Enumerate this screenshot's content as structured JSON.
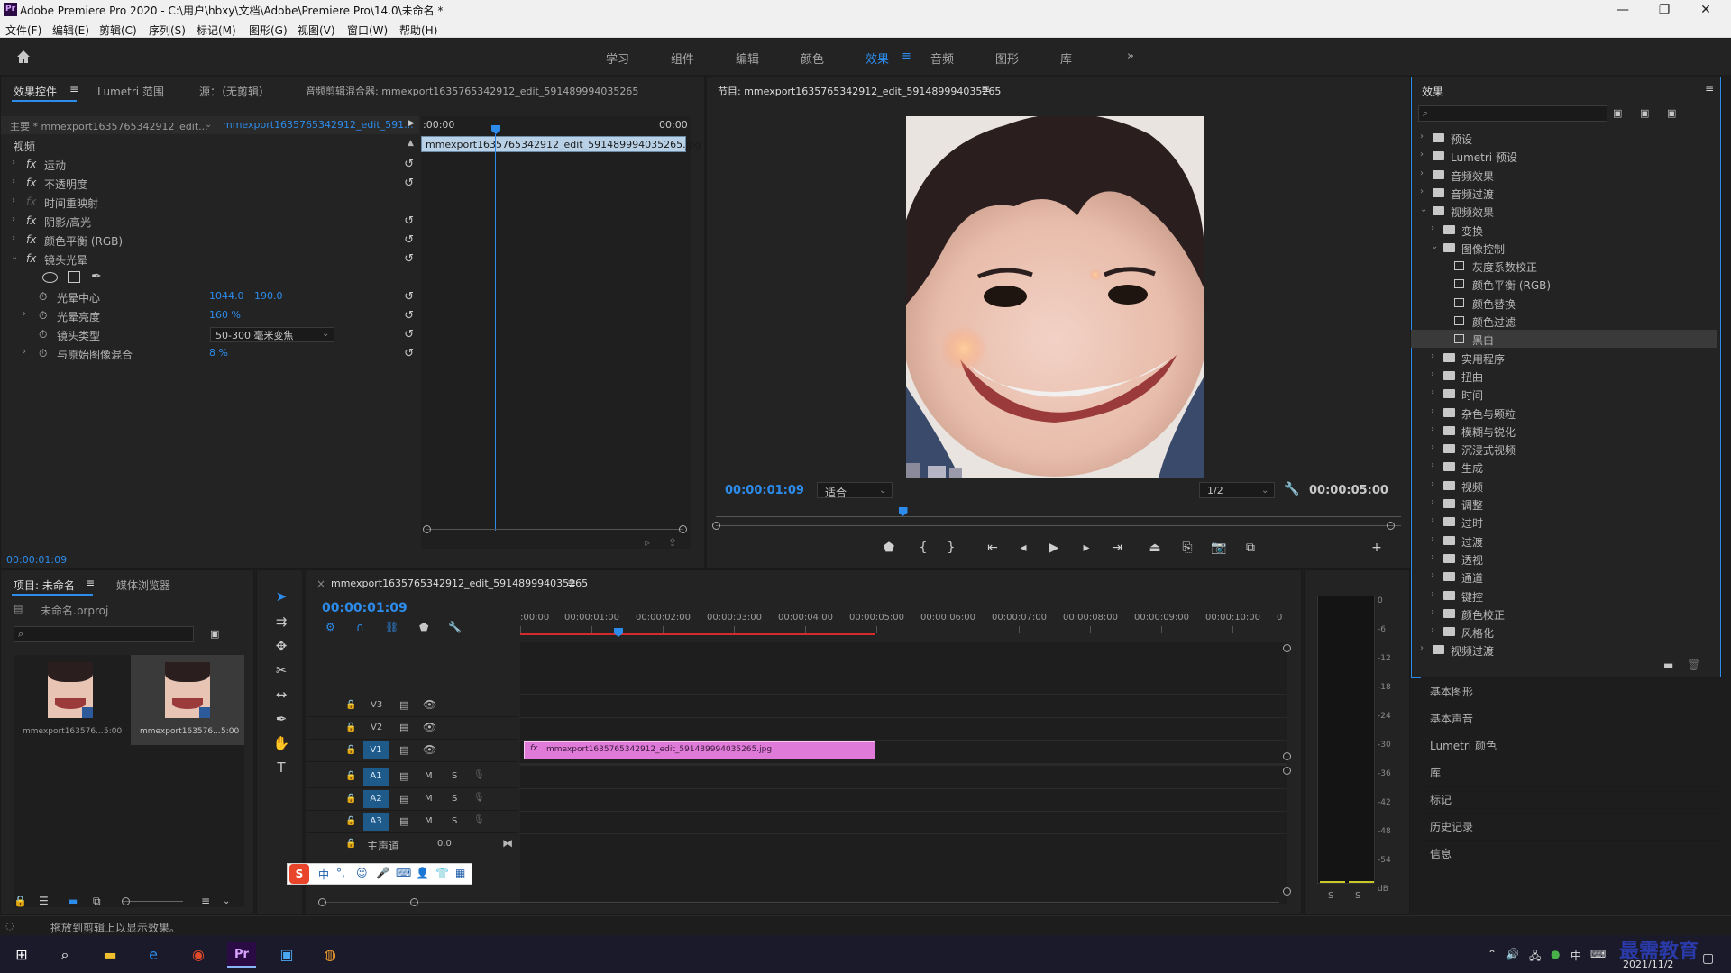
{
  "window": {
    "title": "Adobe Premiere Pro 2020 - C:\\用户\\hbxy\\文档\\Adobe\\Premiere Pro\\14.0\\未命名 *",
    "logo": "Pr",
    "controls": [
      "—",
      "❐",
      "✕"
    ]
  },
  "menu": [
    "文件(F)",
    "编辑(E)",
    "剪辑(C)",
    "序列(S)",
    "标记(M)",
    "图形(G)",
    "视图(V)",
    "窗口(W)",
    "帮助(H)"
  ],
  "workspaces": {
    "items": [
      "学习",
      "组件",
      "编辑",
      "颜色",
      "效果",
      "音频",
      "图形",
      "库"
    ],
    "active": "效果",
    "more": "»"
  },
  "effect_controls": {
    "tabs": [
      "效果控件",
      "Lumetri 范围",
      "源：（无剪辑）",
      "音频剪辑混合器: mmexport1635765342912_edit_591489994035265"
    ],
    "master_label": "主要 * mmexport1635765342912_edit...",
    "clip_label": "mmexport1635765342912_edit_591...",
    "ruler_start": ":00:00",
    "ruler_end": "00:00",
    "clip_bar": "mmexport1635765342912_edit_591489994035265.jpg",
    "section": "视频",
    "effects": [
      {
        "name": "运动"
      },
      {
        "name": "不透明度"
      },
      {
        "name": "时间重映射"
      },
      {
        "name": "阴影/高光"
      },
      {
        "name": "颜色平衡 (RGB)"
      },
      {
        "name": "镜头光晕"
      }
    ],
    "params": [
      {
        "name": "光晕中心",
        "value": "1044.0",
        "value2": "190.0"
      },
      {
        "name": "光晕亮度",
        "value": "160 %"
      },
      {
        "name": "镜头类型",
        "value": "50-300 毫米变焦"
      },
      {
        "name": "与原始图像混合",
        "value": "8 %"
      }
    ],
    "timecode": "00:00:01:09"
  },
  "program": {
    "title": "节目: mmexport1635765342912_edit_591489994035265",
    "timecode": "00:00:01:09",
    "fit": "适合",
    "resolution": "1/2",
    "duration": "00:00:05:00",
    "playhead_fraction": 0.27
  },
  "effects_panel": {
    "title": "效果",
    "search_placeholder": "",
    "items": [
      {
        "label": "预设",
        "level": 0,
        "type": "folder",
        "expanded": false
      },
      {
        "label": "Lumetri 预设",
        "level": 0,
        "type": "folder",
        "expanded": false
      },
      {
        "label": "音频效果",
        "level": 0,
        "type": "folder",
        "expanded": false
      },
      {
        "label": "音频过渡",
        "level": 0,
        "type": "folder",
        "expanded": false
      },
      {
        "label": "视频效果",
        "level": 0,
        "type": "folder",
        "expanded": true
      },
      {
        "label": "变换",
        "level": 1,
        "type": "folder",
        "expanded": false
      },
      {
        "label": "图像控制",
        "level": 1,
        "type": "folder",
        "expanded": true
      },
      {
        "label": "灰度系数校正",
        "level": 2,
        "type": "preset"
      },
      {
        "label": "颜色平衡 (RGB)",
        "level": 2,
        "type": "preset"
      },
      {
        "label": "颜色替换",
        "level": 2,
        "type": "preset"
      },
      {
        "label": "颜色过滤",
        "level": 2,
        "type": "preset"
      },
      {
        "label": "黑白",
        "level": 2,
        "type": "preset",
        "selected": true
      },
      {
        "label": "实用程序",
        "level": 1,
        "type": "folder",
        "expanded": false
      },
      {
        "label": "扭曲",
        "level": 1,
        "type": "folder",
        "expanded": false
      },
      {
        "label": "时间",
        "level": 1,
        "type": "folder",
        "expanded": false
      },
      {
        "label": "杂色与颗粒",
        "level": 1,
        "type": "folder",
        "expanded": false
      },
      {
        "label": "模糊与锐化",
        "level": 1,
        "type": "folder",
        "expanded": false
      },
      {
        "label": "沉浸式视频",
        "level": 1,
        "type": "folder",
        "expanded": false
      },
      {
        "label": "生成",
        "level": 1,
        "type": "folder",
        "expanded": false
      },
      {
        "label": "视频",
        "level": 1,
        "type": "folder",
        "expanded": false
      },
      {
        "label": "调整",
        "level": 1,
        "type": "folder",
        "expanded": false
      },
      {
        "label": "过时",
        "level": 1,
        "type": "folder",
        "expanded": false
      },
      {
        "label": "过渡",
        "level": 1,
        "type": "folder",
        "expanded": false
      },
      {
        "label": "透视",
        "level": 1,
        "type": "folder",
        "expanded": false
      },
      {
        "label": "通道",
        "level": 1,
        "type": "folder",
        "expanded": false
      },
      {
        "label": "键控",
        "level": 1,
        "type": "folder",
        "expanded": false
      },
      {
        "label": "颜色校正",
        "level": 1,
        "type": "folder",
        "expanded": false
      },
      {
        "label": "风格化",
        "level": 1,
        "type": "folder",
        "expanded": false
      },
      {
        "label": "视频过渡",
        "level": 0,
        "type": "folder",
        "expanded": false
      }
    ]
  },
  "side_sections": [
    "基本图形",
    "基本声音",
    "Lumetri 颜色",
    "库",
    "标记",
    "历史记录",
    "信息"
  ],
  "project": {
    "tabs": [
      "项目: 未命名",
      "媒体浏览器"
    ],
    "file": "未命名.prproj",
    "items": [
      {
        "name": "mmexport163576...",
        "duration": "5:00"
      },
      {
        "name": "mmexport163576...",
        "duration": "5:00"
      }
    ]
  },
  "timeline": {
    "sequence_tab": "mmexport1635765342912_edit_591489994035265",
    "timecode": "00:00:01:09",
    "ruler": [
      ":00:00",
      "00:00:01:00",
      "00:00:02:00",
      "00:00:03:00",
      "00:00:04:00",
      "00:00:05:00",
      "00:00:06:00",
      "00:00:07:00",
      "00:00:08:00",
      "00:00:09:00",
      "00:00:10:00",
      "0"
    ],
    "video_tracks": [
      "V3",
      "V2",
      "V1"
    ],
    "audio_tracks": [
      "A1",
      "A2",
      "A3"
    ],
    "master": "主声道",
    "master_value": "0.0",
    "clip": "mmexport1635765342912_edit_591489994035265.jpg",
    "clip_fx": "fx"
  },
  "meter": {
    "labels": [
      "0",
      "-6",
      "-12",
      "-18",
      "-24",
      "-30",
      "-36",
      "-42",
      "-48",
      "-54",
      "dB"
    ],
    "solo": [
      "S",
      "S"
    ]
  },
  "ime": {
    "items": [
      "S",
      "中",
      "°,",
      "☺",
      "🎤",
      "⌨",
      "👤",
      "👕",
      "▦"
    ]
  },
  "status": {
    "text": "拖放到剪辑上以显示效果。"
  },
  "taskbar": {
    "date": "2021/11/2",
    "watermark": "最需教育"
  }
}
